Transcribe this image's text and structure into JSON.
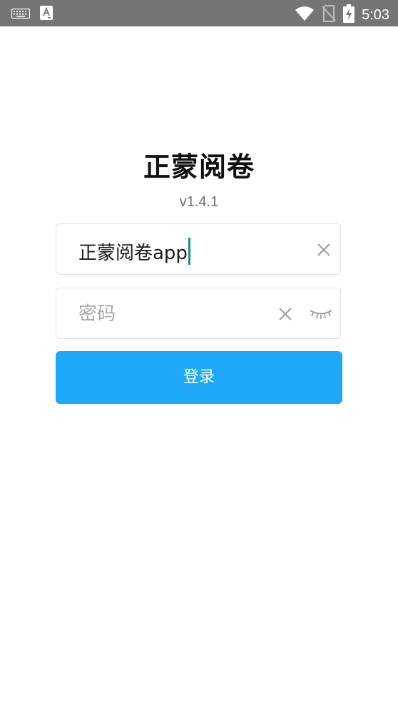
{
  "status_bar": {
    "time": "5:03",
    "icons": [
      "keyboard-icon",
      "text-input-icon",
      "wifi-icon",
      "no-sim-icon",
      "battery-charging-icon"
    ]
  },
  "app": {
    "title": "正蒙阅卷",
    "version": "v1.4.1"
  },
  "form": {
    "username": {
      "value": "正蒙阅卷app",
      "clear_icon": "close-icon"
    },
    "password": {
      "value": "",
      "placeholder": "密码",
      "clear_icon": "close-icon",
      "visibility_icon": "eye-closed-icon"
    },
    "login_label": "登录"
  },
  "colors": {
    "status_bar": "#757575",
    "primary": "#1fa8f7",
    "caret": "#1e8c7f",
    "field_border": "#e2e2e2",
    "placeholder": "#a8a8a8"
  }
}
